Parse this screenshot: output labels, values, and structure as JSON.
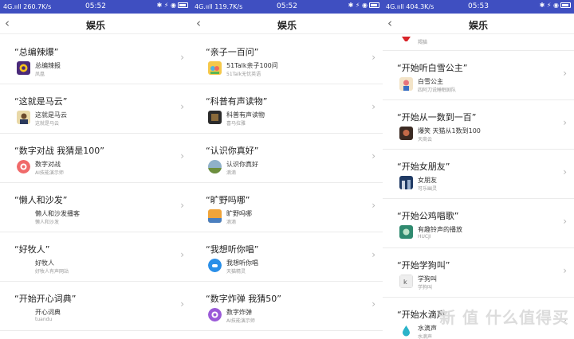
{
  "colors": {
    "statusbar": "#3f4fc1",
    "divider": "#ebebeb",
    "subtitle": "#9a9a9a"
  },
  "panels": [
    {
      "status": {
        "left": "4G.ııll 260.7K/s",
        "time": "05:52",
        "right": "✱ ⚡ ◉"
      },
      "nav": {
        "back": "‹",
        "title": "娱乐"
      },
      "items": [
        {
          "q": "总编辣爆",
          "name": "总编辣报",
          "sub": "凤凰",
          "icon": "yellow-sun-icon"
        },
        {
          "q": "这就是马云",
          "name": "这就是马云",
          "sub": "这就是马云",
          "icon": "portrait-icon"
        },
        {
          "q": "数字对战 我猜是100",
          "name": "数字对战",
          "sub": "AI技能演示师",
          "icon": "red-circle-icon"
        },
        {
          "q": "懒人和沙发",
          "name": "懒人和沙发播客",
          "sub": "懒人和沙发",
          "icon": ""
        },
        {
          "q": "好牧人",
          "name": "好牧人",
          "sub": "好牧人有声网站",
          "icon": ""
        },
        {
          "q": "开始开心词典",
          "name": "开心词典",
          "sub": "tuandu",
          "icon": ""
        }
      ]
    },
    {
      "status": {
        "left": "4G.ııll 119.7K/s",
        "time": "05:52",
        "right": "✱ ⚡ ◉"
      },
      "nav": {
        "back": "‹",
        "title": "娱乐"
      },
      "items": [
        {
          "q": "亲子一百问",
          "name": "51Talk亲子100问",
          "sub": "51Talk无忧英语",
          "icon": "colorful-tile-icon"
        },
        {
          "q": "科普有声读物",
          "name": "科普有声读物",
          "sub": "喜马拉雅",
          "icon": "dark-book-icon"
        },
        {
          "q": "认识你真好",
          "name": "认识你真好",
          "sub": "滴滴",
          "icon": "landscape-icon"
        },
        {
          "q": "旷野吗哪",
          "name": "旷野吗哪",
          "sub": "滴滴",
          "icon": "sunset-icon"
        },
        {
          "q": "我想听你唱",
          "name": "我想听你唱",
          "sub": "天猫精灵",
          "icon": "blue-circle-icon"
        },
        {
          "q": "数字炸弹 我猜50",
          "name": "数字炸弹",
          "sub": "AI技能演示师",
          "icon": "purple-circle-icon"
        }
      ]
    },
    {
      "status": {
        "left": "4G.ııll 404.3K/s",
        "time": "05:53",
        "right": "✱ ⚡ ◉"
      },
      "nav": {
        "back": "‹",
        "title": "娱乐"
      },
      "top_partial": {
        "sub": "羯猫"
      },
      "items": [
        {
          "q": "开始听白雪公主",
          "name": "白雪公主",
          "sub": "四阿刀说睡眠剧队",
          "icon": "snow-white-icon"
        },
        {
          "q": "开始从一数到一百",
          "name": "爆笑 天猫从1数到100",
          "sub": "天商云",
          "icon": "dark-photo-icon"
        },
        {
          "q": "开始女朋友",
          "name": "女朋友",
          "sub": "可乐幽灵",
          "icon": "blue-photo-icon"
        },
        {
          "q": "开始公鸡唱歌",
          "name": "有趣铃声的播放",
          "sub": "HUCJI",
          "icon": "green-photo-icon"
        },
        {
          "q": "开始学狗叫",
          "name": "学狗叫",
          "sub": "学狗叫",
          "icon": "gray-tile-icon"
        },
        {
          "q": "开始水滴声",
          "name": "水滴声",
          "sub": "水滴声",
          "icon": "water-drop-icon"
        }
      ]
    }
  ],
  "watermark": "新 值 什么值得买"
}
